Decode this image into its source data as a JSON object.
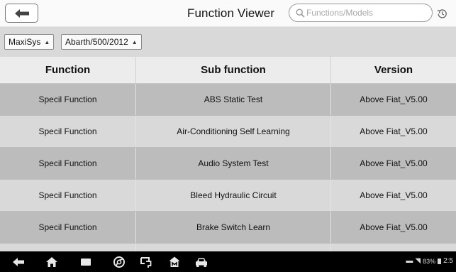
{
  "header": {
    "title": "Function Viewer",
    "search_placeholder": "Functions/Models"
  },
  "filters": {
    "chip1": "MaxiSys",
    "chip2": "Abarth/500/2012"
  },
  "table": {
    "headers": [
      "Function",
      "Sub function",
      "Version"
    ],
    "rows": [
      {
        "function": "Specil Function",
        "sub": "ABS Static Test",
        "version": "Above Fiat_V5.00"
      },
      {
        "function": "Specil Function",
        "sub": "Air-Conditioning Self Learning",
        "version": "Above Fiat_V5.00"
      },
      {
        "function": "Specil Function",
        "sub": "Audio System Test",
        "version": "Above Fiat_V5.00"
      },
      {
        "function": "Specil Function",
        "sub": "Bleed Hydraulic Circuit",
        "version": "Above Fiat_V5.00"
      },
      {
        "function": "Specil Function",
        "sub": "Brake Switch Learn",
        "version": "Above Fiat_V5.00"
      },
      {
        "function": "",
        "sub": "",
        "version": ""
      }
    ]
  },
  "navbar": {
    "icons": [
      "back-icon",
      "home-icon",
      "recent-apps-icon",
      "browser-icon",
      "screenshot-icon",
      "maxisys-home-icon",
      "car-icon"
    ],
    "battery": "83%",
    "time": "2:5"
  },
  "colors": {
    "row_dark": "#bcbcbc",
    "row_light": "#d9d9d9",
    "filter_bar": "#d9d9d9",
    "nav_bar": "#000000"
  }
}
